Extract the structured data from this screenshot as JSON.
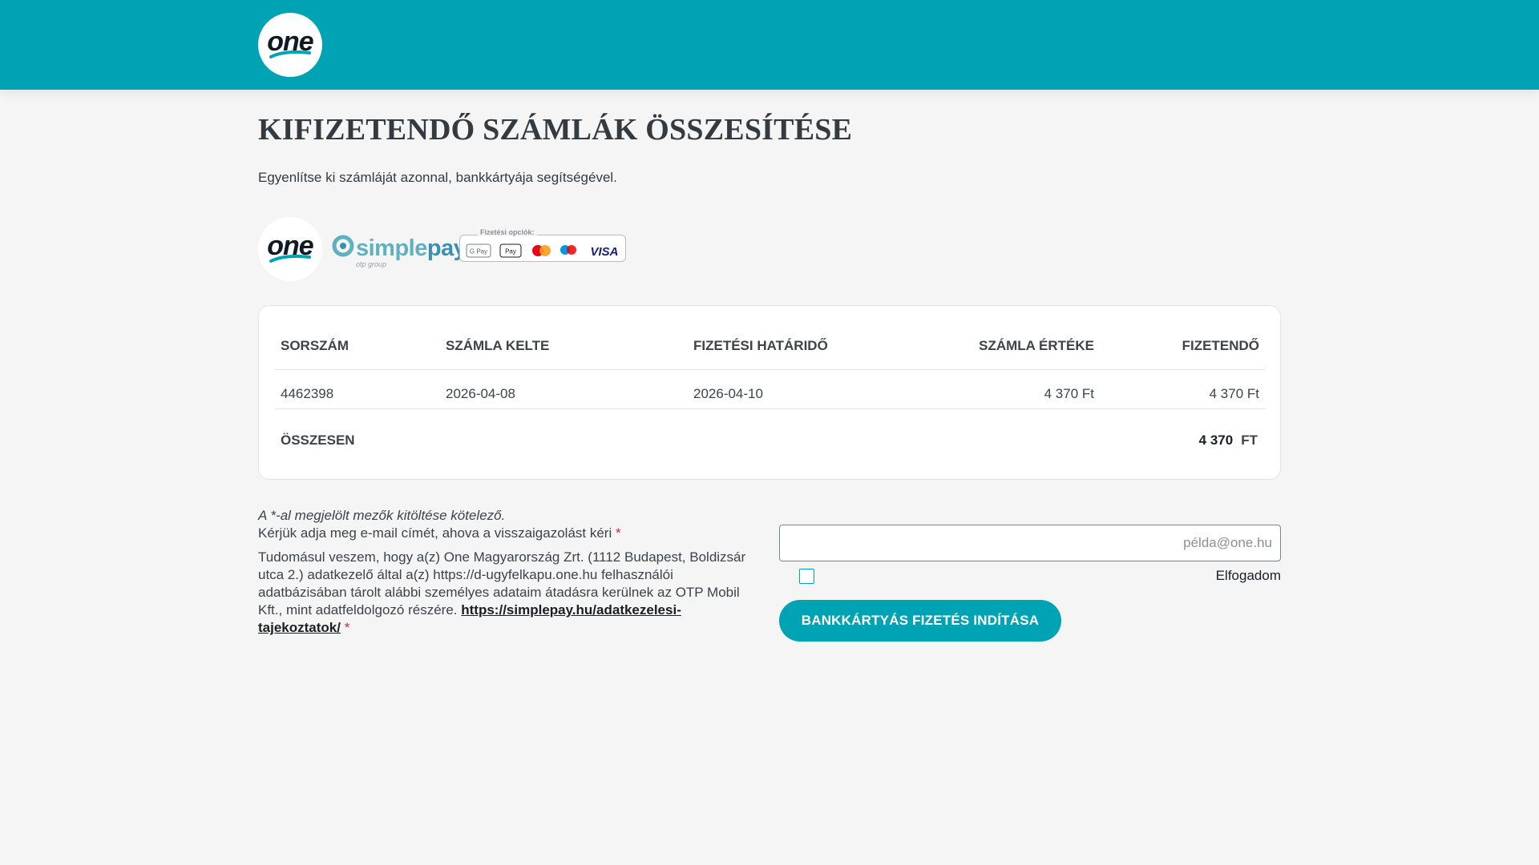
{
  "header": {
    "logo_text": "one"
  },
  "page": {
    "title": "KIFIZETENDŐ SZÁMLÁK ÖSSZESÍTÉSE",
    "subtitle": "Egyenlítse ki számláját azonnal, bankkártyája segítségével."
  },
  "brands": {
    "one_logo_text": "one",
    "simplepay_simple": "simple",
    "simplepay_pay": "pay",
    "simplepay_sub": "otp group",
    "payment_options_label": "Fizetési opciók:",
    "methods": [
      "G Pay",
      "Pay",
      "Mastercard",
      "Maestro",
      "VISA"
    ]
  },
  "table": {
    "headers": {
      "sorszam": "SORSZÁM",
      "kelte": "SZÁMLA KELTE",
      "hatarido": "FIZETÉSI HATÁRIDŐ",
      "ertek": "SZÁMLA ÉRTÉKE",
      "fizetendo": "FIZETENDŐ"
    },
    "rows": [
      {
        "sorszam": "4462398",
        "kelte": "2026-04-08",
        "hatarido": "2026-04-10",
        "ertek": "4 370 Ft",
        "fizetendo": "4 370 Ft"
      }
    ],
    "total": {
      "label": "ÖSSZESEN",
      "amount": "4 370",
      "currency": "FT"
    }
  },
  "form": {
    "required_note": "A *-al megjelölt mezők kitöltése kötelező.",
    "email_label": "Kérjük adja meg e-mail címét, ahova a visszaigazolást kéri",
    "required_mark": "*",
    "email_value": "",
    "email_placeholder": "példa@one.hu",
    "consent_text": "Tudomásul veszem, hogy a(z) One Magyarország Zrt. (1112 Budapest, Boldizsár utca 2.) adatkezelő által a(z) https://d-ugyfelkapu.one.hu felhasználói adatbázisában tárolt alábbi személyes adataim átadásra kerülnek az OTP Mobil Kft., mint adatfeldolgozó részére.",
    "consent_link": "https://simplepay.hu/adatkezelesi-tajekoztatok/",
    "accept_label": "Elfogadom",
    "accept_checked": false,
    "submit_label": "BANKKÁRTYÁS FIZETÉS INDÍTÁSA"
  },
  "colors": {
    "brand_teal": "#00a3b4",
    "background": "#f5f5f5",
    "text": "#333a40",
    "required": "#d9262c"
  }
}
